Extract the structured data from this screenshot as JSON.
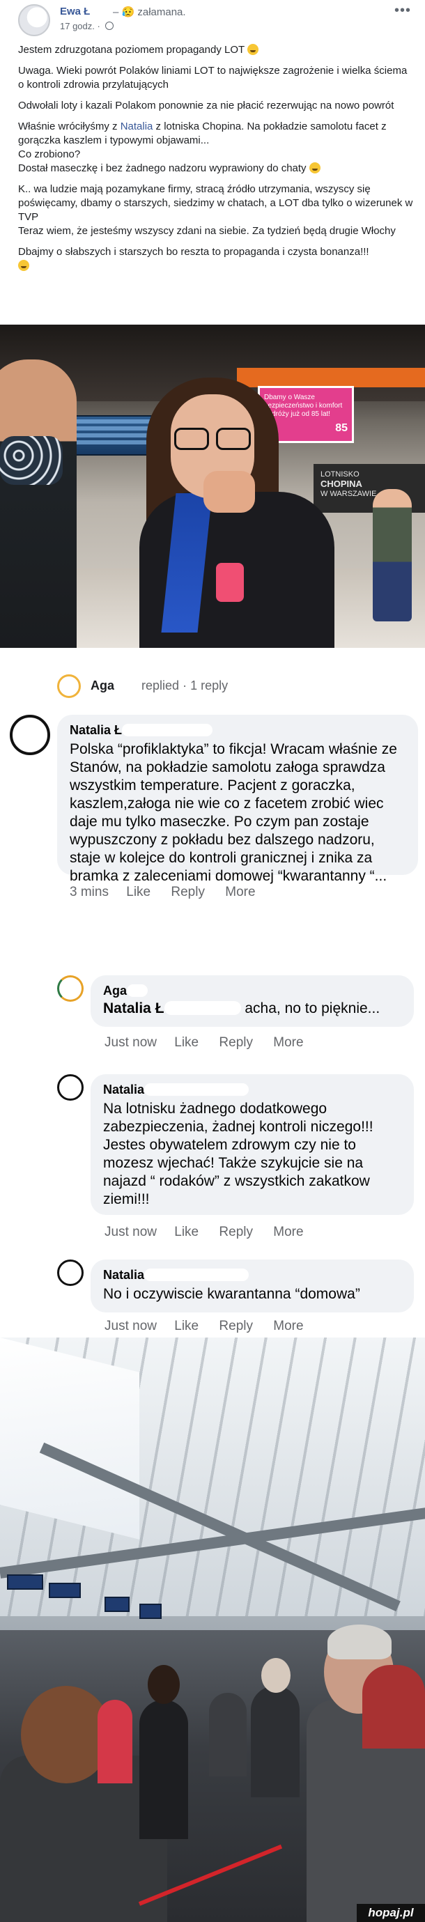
{
  "post": {
    "author": "Ewa Ł",
    "feeling": "– 😥 załamana.",
    "time": "17 godz.",
    "menu": "•••",
    "paragraphs": [
      "Jestem zdruzgotana poziomem propagandy LOT",
      "Uwaga. Wieki powrót Polaków liniami LOT to największe zagrożenie i wielka ściema o kontroli zdrowia przylatujących",
      "Odwołali loty i kazali Polakom ponownie za nie płacić rezerwując na nowo powrót",
      "K.. wa ludzie mają pozamykane firmy, stracą źródło utrzymania, wszyscy się poświęcamy, dbamy o starszych, siedzimy w chatach, a LOT dba tylko o wizerunek w TVP\nTeraz wiem, że jesteśmy wszyscy zdani na siebie. Za tydzień będą drugie Włochy",
      "Dbajmy o słabszych i starszych bo reszta to propaganda i czysta bonanza!!!"
    ],
    "para4_a": "Właśnie wróciłyśmy z ",
    "para4_tag": "Natalia",
    "para4_b": " z lotniska Chopina. Na pokładzie samolotu facet z gorączka kaszlem i typowymi objawami...\nCo zrobiono?\nDostał maseczkę i bez żadnego nadzoru wyprawiony do chaty"
  },
  "photo1": {
    "sign_text": "Dbamy o Wasze bezpieczeństwo i komfort podróży już od 85 lat!",
    "sign_number": "85",
    "chopin_line1": "LOTNISKO",
    "chopin_line2": "CHOPINA",
    "chopin_line3": "W WARSZAWIE"
  },
  "comments": {
    "reply_summary": {
      "name": "Aga",
      "action": "replied",
      "count": "· 1 reply"
    },
    "items": [
      {
        "name": "Natalia Ł",
        "text": "Polska “profiklaktyka” to fikcja! Wracam właśnie ze Stanów, na pokładzie samolotu załoga sprawdza wszystkim temperature. Pacjent z goraczka, kaszlem,załoga nie wie co z facetem zrobić wiec daje mu tylko maseczke. Po czym pan zostaje wypuszczony z pokładu bez dalszego nadzoru, staje w kolejce do kontroli granicznej i znika za bramka z zaleceniami domowej “kwarantanny “...",
        "time": "3 mins",
        "like": "Like",
        "reply": "Reply",
        "more": "More"
      },
      {
        "name": "Aga",
        "mention": "Natalia Ł",
        "text": "acha, no to pięknie...",
        "time": "Just now",
        "like": "Like",
        "reply": "Reply",
        "more": "More"
      },
      {
        "name": "Natalia",
        "text": "Na lotnisku żadnego dodatkowego zabezpieczenia, żadnej kontroli niczego!!! Jestes obywatelem zdrowym czy nie to mozesz wjechać! Także szykujcie sie na najazd “ rodaków” z wszystkich zakatkow ziemi!!!",
        "time": "Just now",
        "like": "Like",
        "reply": "Reply",
        "more": "More"
      },
      {
        "name": "Natalia",
        "text": "No i oczywiscie kwarantanna “domowa”",
        "time": "Just now",
        "like": "Like",
        "reply": "Reply",
        "more": "More"
      }
    ]
  },
  "watermark": "hopaj.pl",
  "colors": {
    "link": "#385898",
    "bubble": "#f0f2f5",
    "meta": "#65676b",
    "sign_pink": "#e33e8d"
  }
}
